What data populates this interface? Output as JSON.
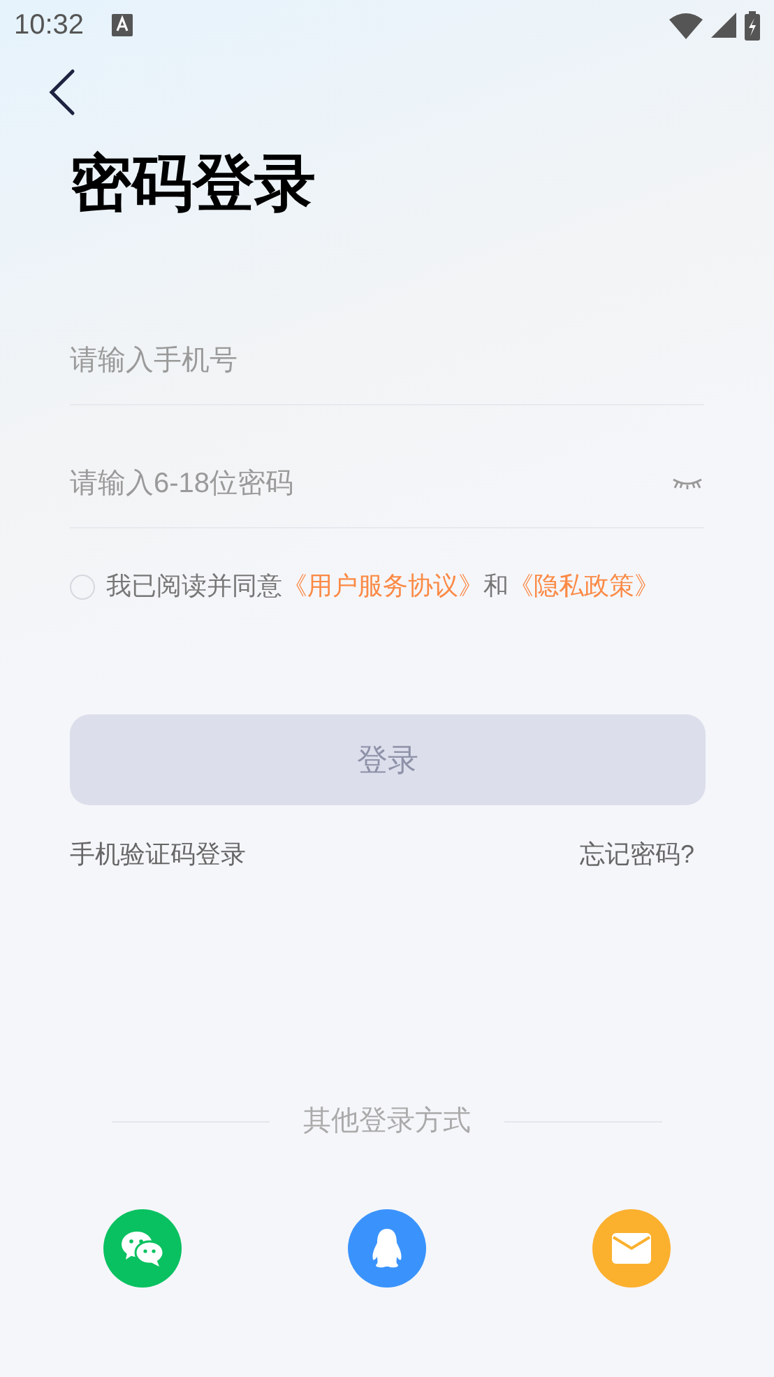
{
  "status_bar": {
    "time": "10:32"
  },
  "title": "密码登录",
  "phone_field": {
    "placeholder": "请输入手机号"
  },
  "password_field": {
    "placeholder": "请输入6-18位密码",
    "visible": false
  },
  "agreement": {
    "checked": false,
    "text": "我已阅读并同意",
    "links": [
      "《用户服务协议》",
      "《隐私政策》"
    ],
    "joiner": "和"
  },
  "login_button": {
    "label": "登录",
    "disabled": true
  },
  "links": [
    "手机验证码登录",
    "忘记密码?"
  ],
  "other_login": {
    "label": "其他登录方式",
    "methods": [
      {
        "kind": "wechat"
      },
      {
        "kind": "qq"
      },
      {
        "kind": "mail"
      }
    ]
  }
}
